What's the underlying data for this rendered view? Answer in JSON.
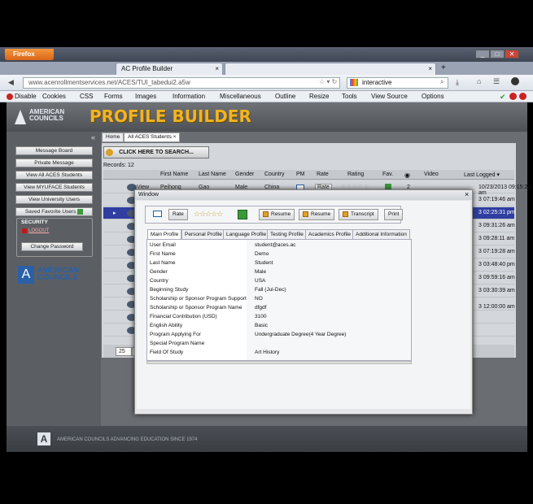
{
  "browser": {
    "app_button": "Firefox",
    "tabs": [
      {
        "label": "AC Profile Builder"
      },
      {
        "label": ""
      }
    ],
    "new_tab": "+",
    "url": "www.acenrollmentservices.net/ACES/TUI_tabedui2.a5w",
    "search_value": "interactive",
    "devbar": [
      "Disable",
      "Cookies",
      "CSS",
      "Forms",
      "Images",
      "Information",
      "Miscellaneous",
      "Outline",
      "Resize",
      "Tools",
      "View Source",
      "Options"
    ]
  },
  "header": {
    "logo_line1": "AMERICAN",
    "logo_line2": "COUNCILS",
    "title": "PROFILE BUILDER"
  },
  "sidebar": {
    "collapse": "«",
    "buttons": [
      "Message Board",
      "Private Message",
      "View All ACES Students",
      "View MYUFACE Students",
      "View University Users",
      "Saved Favorite Users"
    ],
    "security_title": "SECURITY",
    "logout": "LOGOUT",
    "change_password": "Change Password",
    "logo_line1": "AMERICAN",
    "logo_line2": "COUNCILS"
  },
  "content": {
    "tabs": [
      "Home",
      "All ACES Students"
    ],
    "search_button": "CLICK HERE TO SEARCH...",
    "records": "Records:  12",
    "columns": [
      "First Name",
      "Last Name",
      "Gender",
      "Country",
      "PM",
      "Rate",
      "Rating",
      "Fav.",
      "Video",
      "Last Logged"
    ],
    "first_row": {
      "view": "View",
      "first": "Peihong",
      "last": "Gao",
      "gender": "Male",
      "country": "China",
      "rate": "Rate",
      "count": "2"
    },
    "row_dates": [
      "10/23/2013 09:15:20 am",
      "3 07:19:46 am",
      "3 02:25:31 pm",
      "3 09:31:26 am",
      "3 09:28:11 am",
      "3 07:19:28 am",
      "3 03:48:40 pm",
      "3 09:59:16 am",
      "3 03:30:39 am",
      "3 12:00:00 am"
    ],
    "page_size": "25"
  },
  "footer": {
    "text": "AMERICAN COUNCILS ADVANCING EDUCATION SINCE 1974"
  },
  "modal": {
    "title": "Window",
    "close": "×",
    "toolbar": {
      "rate": "Rate",
      "resume1": "Resume",
      "resume2": "Resume",
      "transcript": "Transcript",
      "print": "Print",
      "stars": "☆☆☆☆☆"
    },
    "tabs": [
      "Main Profile",
      "Personal Profile",
      "Language Profile",
      "Testing Profile",
      "Academics Profile",
      "Additional Information"
    ],
    "fields": [
      {
        "label": "User Email",
        "value": "student@aces.ac"
      },
      {
        "label": "First Name",
        "value": "Demo"
      },
      {
        "label": "Last Name",
        "value": "Student"
      },
      {
        "label": "Gender",
        "value": "Male"
      },
      {
        "label": "Country",
        "value": "USA"
      },
      {
        "label": "Beginning Study",
        "value": "Fall (Jul-Dec)"
      },
      {
        "label": "Scholarship or Sponsor Program Support",
        "value": "NO"
      },
      {
        "label": "Scholarship or Sponsor Program Name",
        "value": "dfgdf"
      },
      {
        "label": "Financial Contribution (USD)",
        "value": "3100"
      },
      {
        "label": "English Ability",
        "value": "Basic"
      },
      {
        "label": "Program Applying For",
        "value": "Undergraduate Degree(4 Year Degree)"
      },
      {
        "label": "Special Program Name",
        "value": ""
      },
      {
        "label": "Field Of Study",
        "value": "Art History"
      }
    ]
  },
  "colors": {
    "accent": "#f2b422",
    "brand_blue": "#2a60a8",
    "selected_row": "#2f3ea0"
  }
}
